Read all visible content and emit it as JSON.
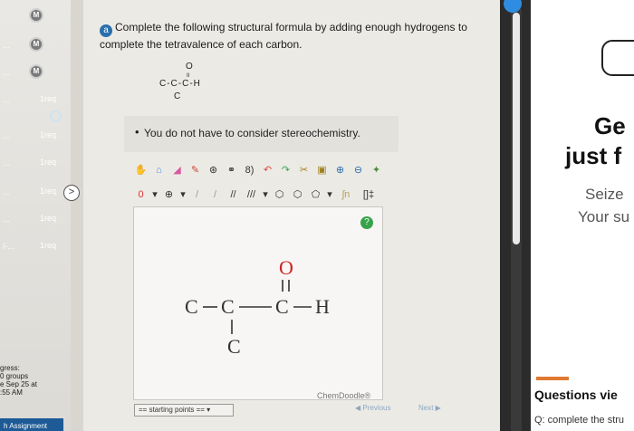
{
  "sidebar": {
    "items": [
      {
        "label": "",
        "badge": "M"
      },
      {
        "label": "",
        "badge": "M"
      },
      {
        "label": "",
        "badge": "M"
      },
      {
        "label": "1req",
        "badge": ""
      },
      {
        "label": "1req",
        "badge": ""
      },
      {
        "label": "1req",
        "badge": ""
      },
      {
        "label": "1req",
        "badge": ""
      },
      {
        "label": "1req",
        "badge": ""
      },
      {
        "label": "1req",
        "badge": ""
      }
    ],
    "dots": "...",
    "dots_alt": "/-...",
    "progress": [
      "gress:",
      "0 groups",
      "e Sep 25 at",
      ":55 AM"
    ],
    "bottom_tab": "h Assignment",
    "nav_arrow": ">"
  },
  "question": {
    "badge": "a",
    "prompt": "Complete the following structural formula by adding enough hydrogens to complete the tetravalence of each carbon.",
    "structure_top": "O",
    "structure_double": "II",
    "structure_main": "C-C-C-H",
    "structure_bottom": "C",
    "note": "You do not have to consider stereochemistry."
  },
  "editor": {
    "help": "?",
    "brand": "ChemDoodle®",
    "starting_points": "== starting points ==",
    "prev": "Previous",
    "next": "Next",
    "toolbar_row1": [
      "hand-icon",
      "lasso-icon",
      "eraser-icon",
      "pencil-icon",
      "ring-icon",
      "chain-icon",
      "undo-icon",
      "redo-icon",
      "template-icon",
      "clipboard-icon",
      "zoom-in-icon",
      "zoom-out-icon",
      "clean-icon"
    ],
    "toolbar_row2_labels": [
      "0",
      "⊕",
      "/",
      "/",
      "//",
      "///",
      "⬡",
      "⬡",
      "⬠",
      "ʃn",
      "[]‡"
    ]
  },
  "right_panel": {
    "heading": "Ge",
    "heading2": "just f",
    "line1": "Seize",
    "line2": "Your su",
    "questions_title": "Questions vie",
    "question_preview": "Q: complete the stru"
  }
}
